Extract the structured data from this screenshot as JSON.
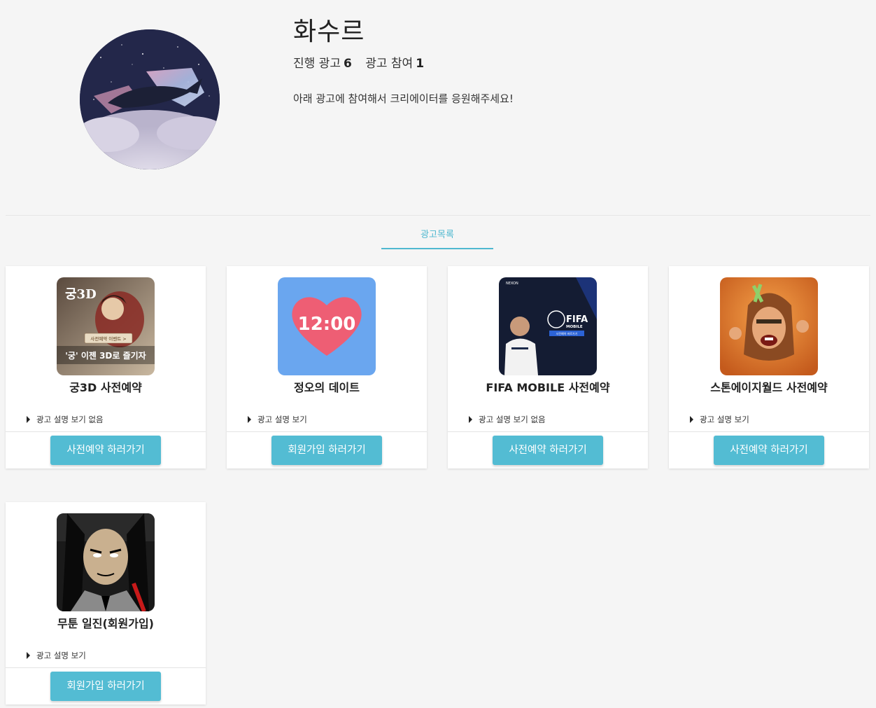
{
  "profile": {
    "name": "화수르",
    "stats": {
      "active_ads_label": "진행 광고",
      "active_ads_count": "6",
      "participated_label": "광고 참여",
      "participated_count": "1"
    },
    "description": "아래 광고에 참여해서 크리에이터를 응원해주세요!"
  },
  "tabs": [
    {
      "label": "광고목록",
      "active": true
    }
  ],
  "theme": {
    "accent": "#53bcd3",
    "tab_color": "#4fb8d0",
    "background": "#f5f5f5"
  },
  "ads": [
    {
      "title": "궁3D 사전예약",
      "info": "광고 설명 보기 없음",
      "button": "사전예약 하러가기",
      "thumb_text": "사전예약 이벤트 >",
      "thumb_slogan": "'궁' 이젠 3D로 즐기자",
      "thumb_logo": "궁3D"
    },
    {
      "title": "정오의 데이트",
      "info": "광고 설명 보기",
      "button": "회원가입 하러가기",
      "thumb_text": "12:00"
    },
    {
      "title": "FIFA MOBILE 사전예약",
      "info": "광고 설명 보기 없음",
      "button": "사전예약 하러가기",
      "thumb_brand": "NEXON",
      "thumb_text": "FIFA",
      "thumb_sub": "MOBILE",
      "thumb_cta": "사전예약 바로가기"
    },
    {
      "title": "스톤에이지월드 사전예약",
      "info": "광고 설명 보기",
      "button": "사전예약 하러가기"
    },
    {
      "title": "무툰 일진(회원가입)",
      "info": "광고 설명 보기",
      "button": "회원가입 하러가기"
    }
  ]
}
